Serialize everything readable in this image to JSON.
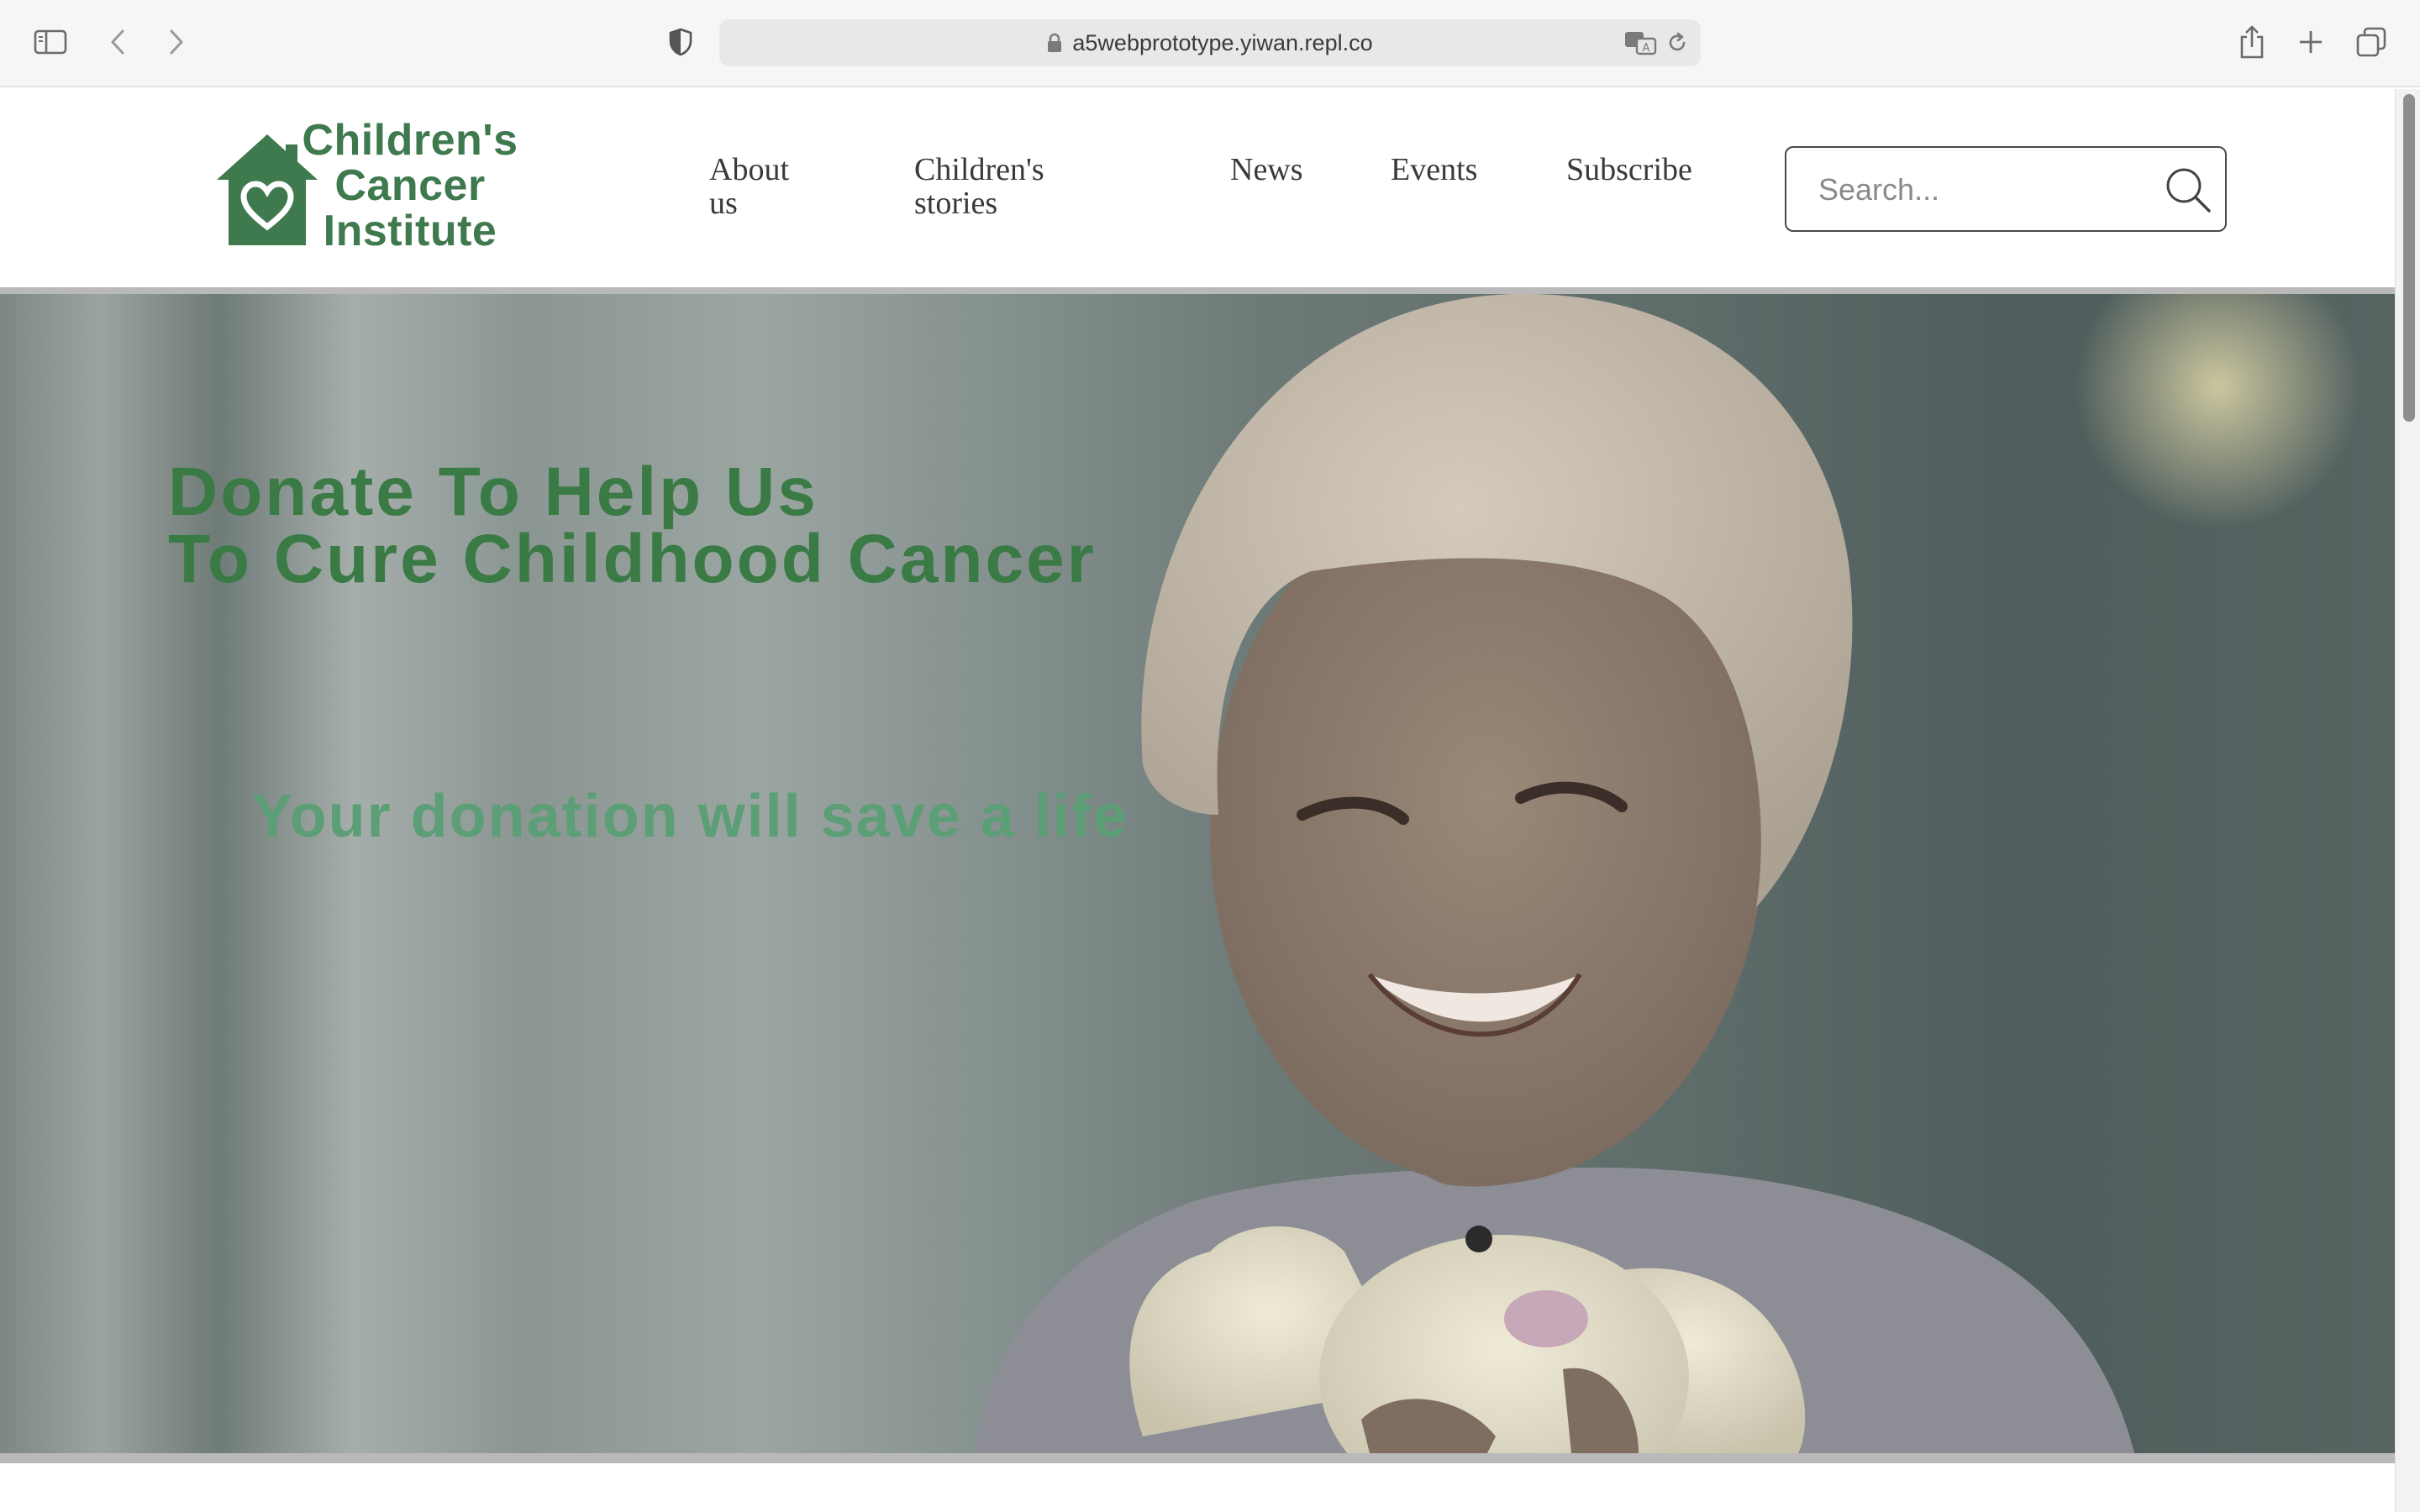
{
  "browser": {
    "url": "a5webprototype.yiwan.repl.co",
    "icons": [
      "sidebar-icon",
      "back-icon",
      "forward-icon",
      "shield-icon",
      "lock-icon",
      "translate-icon",
      "reload-icon",
      "share-icon",
      "new-tab-icon",
      "tabs-icon"
    ]
  },
  "site": {
    "logo_lines": [
      "Children's",
      "Cancer",
      "Institute"
    ],
    "nav": {
      "about": "About us",
      "stories": "Children's stories",
      "news": "News",
      "events": "Events",
      "subscribe": "Subscribe"
    },
    "search": {
      "placeholder": "Search..."
    }
  },
  "hero": {
    "title_line1": "Donate To Help Us",
    "title_line2": "To Cure Childhood Cancer",
    "subtitle": "Your donation will save a life"
  },
  "colors": {
    "brand_green": "#3f7a4e",
    "hero_title": "#3a7a45",
    "hero_subtitle": "#5c9e76"
  }
}
